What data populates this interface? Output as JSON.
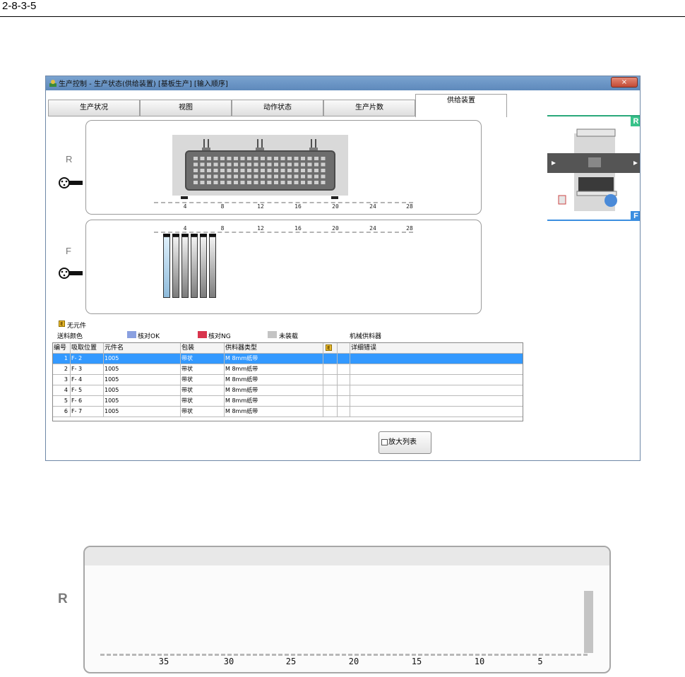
{
  "page_ref": "2-8-3-5",
  "window": {
    "title": "生产控制 - 生产状态(供给装置) [基板生产] [输入顺序]",
    "close_label": "×"
  },
  "tabs": [
    {
      "label": "生产状况"
    },
    {
      "label": "视图"
    },
    {
      "label": "动作状态"
    },
    {
      "label": "生产片数"
    },
    {
      "label": "供给装置",
      "active": true
    }
  ],
  "panels": {
    "rear": {
      "side": "R",
      "ticks": [
        "4",
        "8",
        "12",
        "16",
        "20",
        "24",
        "28"
      ]
    },
    "front": {
      "side": "F",
      "ticks": [
        "4",
        "8",
        "12",
        "16",
        "20",
        "24",
        "28"
      ]
    }
  },
  "machine_labels": {
    "rear": "R",
    "front": "F"
  },
  "legend": {
    "e_mark": "E",
    "no_component": "无元件",
    "feed_color_label": "送料颜色",
    "ok": "核对OK",
    "ng": "核对NG",
    "not_loaded": "未装载",
    "mechanical": "机械供料器",
    "colors": {
      "ok": "#8aa0e0",
      "ng": "#d9354d",
      "not_loaded": "#c4c4c4",
      "selected_row": "#3399ff"
    }
  },
  "table": {
    "headers": [
      "编号",
      "吸取位置",
      "元件名",
      "包装",
      "供料器类型",
      "E",
      "",
      "详细错误"
    ],
    "rows": [
      {
        "no": "1",
        "pos": "F- 2",
        "part": "1005",
        "pack": "带状",
        "type": "M 8mm纸带",
        "selected": true
      },
      {
        "no": "2",
        "pos": "F- 3",
        "part": "1005",
        "pack": "带状",
        "type": "M 8mm纸带"
      },
      {
        "no": "3",
        "pos": "F- 4",
        "part": "1005",
        "pack": "带状",
        "type": "M 8mm纸带"
      },
      {
        "no": "4",
        "pos": "F- 5",
        "part": "1005",
        "pack": "带状",
        "type": "M 8mm纸带"
      },
      {
        "no": "5",
        "pos": "F- 6",
        "part": "1005",
        "pack": "带状",
        "type": "M 8mm纸带"
      },
      {
        "no": "6",
        "pos": "F- 7",
        "part": "1005",
        "pack": "带状",
        "type": "M 8mm纸带"
      }
    ]
  },
  "zoom_button": {
    "label": "放大列表"
  },
  "enlarged": {
    "side": "R",
    "ticks": [
      "35",
      "30",
      "25",
      "20",
      "15",
      "10",
      "5"
    ]
  }
}
